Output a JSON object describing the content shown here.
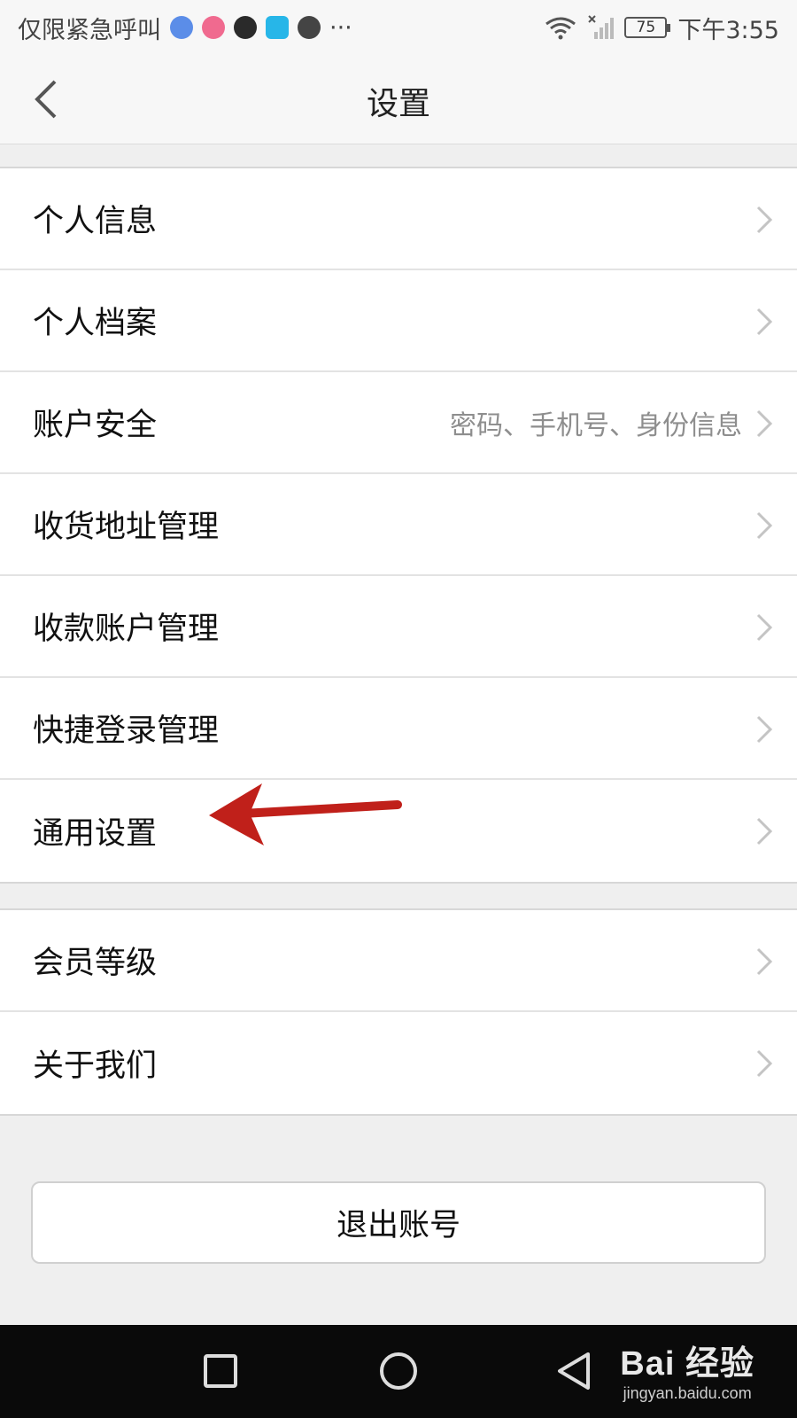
{
  "status_bar": {
    "carrier_text": "仅限紧急呼叫",
    "more": "···",
    "battery": "75",
    "time": "下午3:55",
    "app_icons": [
      "compass-icon",
      "candy-app-icon",
      "smile-app-icon",
      "e-app-icon",
      "wechat-icon"
    ]
  },
  "header": {
    "title": "设置",
    "back_icon": "chevron-left-icon"
  },
  "group1": [
    {
      "label": "个人信息",
      "hint": ""
    },
    {
      "label": "个人档案",
      "hint": ""
    },
    {
      "label": "账户安全",
      "hint": "密码、手机号、身份信息"
    },
    {
      "label": "收货地址管理",
      "hint": ""
    },
    {
      "label": "收款账户管理",
      "hint": ""
    },
    {
      "label": "快捷登录管理",
      "hint": ""
    },
    {
      "label": "通用设置",
      "hint": ""
    }
  ],
  "group2": [
    {
      "label": "会员等级"
    },
    {
      "label": "关于我们"
    }
  ],
  "logout_label": "退出账号",
  "watermark": {
    "logo": "Bai 经验",
    "url": "jingyan.baidu.com"
  },
  "colors": {
    "annotation_arrow": "#c0201a",
    "background": "#efefef",
    "nav_bar": "#0a0a0a"
  }
}
